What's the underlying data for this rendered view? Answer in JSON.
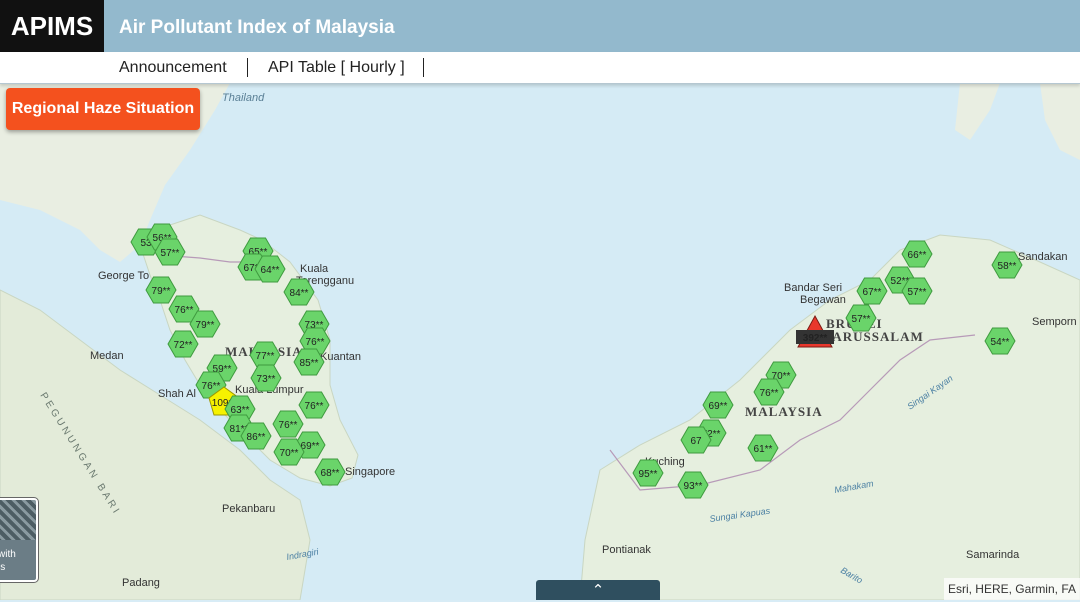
{
  "header": {
    "logo": "APIMS",
    "title": "Air Pollutant Index of Malaysia",
    "color": "#93b9cd"
  },
  "nav": {
    "items": [
      "Announcement",
      "API Table [ Hourly ]"
    ]
  },
  "haze_button": {
    "label": "Regional Haze Situation",
    "color": "#f4511e"
  },
  "basemap_toggle": {
    "label_lines": [
      "with",
      "ls"
    ]
  },
  "expand_tab": {
    "icon": "chevron-up-icon",
    "glyph": "⌃"
  },
  "attribution": "Esri, HERE, Garmin, FA",
  "map": {
    "place_labels": [
      "Thailand",
      "George To",
      "Kuala",
      "Terengganu",
      "Medan",
      "MALAYSIA",
      "Kuantan",
      "Kuala Lumpur",
      "Shah Al",
      "Singapore",
      "Pekanbaru",
      "Padang",
      "Bandar Seri",
      "Begawan",
      "BRUNEI",
      "DARUSSALAM",
      "MALAYSIA",
      "Kuching",
      "Sandakan",
      "Semporn",
      "Pontianak",
      "Samarinda",
      "Sungai Kapuas",
      "Mahakam",
      "Barito",
      "Indragiri",
      "Singai Kayan",
      "PEGUNUNGAN BARI"
    ],
    "colors": {
      "good": "#6ad46a",
      "moderate": "#f6f200",
      "hazardous": "#e8372c"
    },
    "stations": [
      {
        "label": "53",
        "status": "good"
      },
      {
        "label": "56**",
        "status": "good"
      },
      {
        "label": "57**",
        "status": "good"
      },
      {
        "label": "65**",
        "status": "good"
      },
      {
        "label": "67**",
        "status": "good"
      },
      {
        "label": "64**",
        "status": "good"
      },
      {
        "label": "79**",
        "status": "good"
      },
      {
        "label": "84**",
        "status": "good"
      },
      {
        "label": "76**",
        "status": "good"
      },
      {
        "label": "79**",
        "status": "good"
      },
      {
        "label": "73**",
        "status": "good"
      },
      {
        "label": "76**",
        "status": "good"
      },
      {
        "label": "72**",
        "status": "good"
      },
      {
        "label": "77**",
        "status": "good"
      },
      {
        "label": "85**",
        "status": "good"
      },
      {
        "label": "59**",
        "status": "good"
      },
      {
        "label": "73**",
        "status": "good"
      },
      {
        "label": "76**",
        "status": "good"
      },
      {
        "label": "109**",
        "status": "moderate"
      },
      {
        "label": "63**",
        "status": "good"
      },
      {
        "label": "76**",
        "status": "good"
      },
      {
        "label": "81**",
        "status": "good"
      },
      {
        "label": "86**",
        "status": "good"
      },
      {
        "label": "76**",
        "status": "good"
      },
      {
        "label": "69**",
        "status": "good"
      },
      {
        "label": "70**",
        "status": "good"
      },
      {
        "label": "68**",
        "status": "good"
      },
      {
        "label": "66**",
        "status": "good"
      },
      {
        "label": "52**",
        "status": "good"
      },
      {
        "label": "57**",
        "status": "good"
      },
      {
        "label": "67**",
        "status": "good"
      },
      {
        "label": "57**",
        "status": "good"
      },
      {
        "label": "58**",
        "status": "good"
      },
      {
        "label": "54**",
        "status": "good"
      },
      {
        "label": "392**",
        "status": "hazardous"
      },
      {
        "label": "70**",
        "status": "good"
      },
      {
        "label": "76**",
        "status": "good"
      },
      {
        "label": "69**",
        "status": "good"
      },
      {
        "label": "72**",
        "status": "good"
      },
      {
        "label": "67",
        "status": "good"
      },
      {
        "label": "61**",
        "status": "good"
      },
      {
        "label": "95**",
        "status": "good"
      },
      {
        "label": "93**",
        "status": "good"
      }
    ]
  }
}
